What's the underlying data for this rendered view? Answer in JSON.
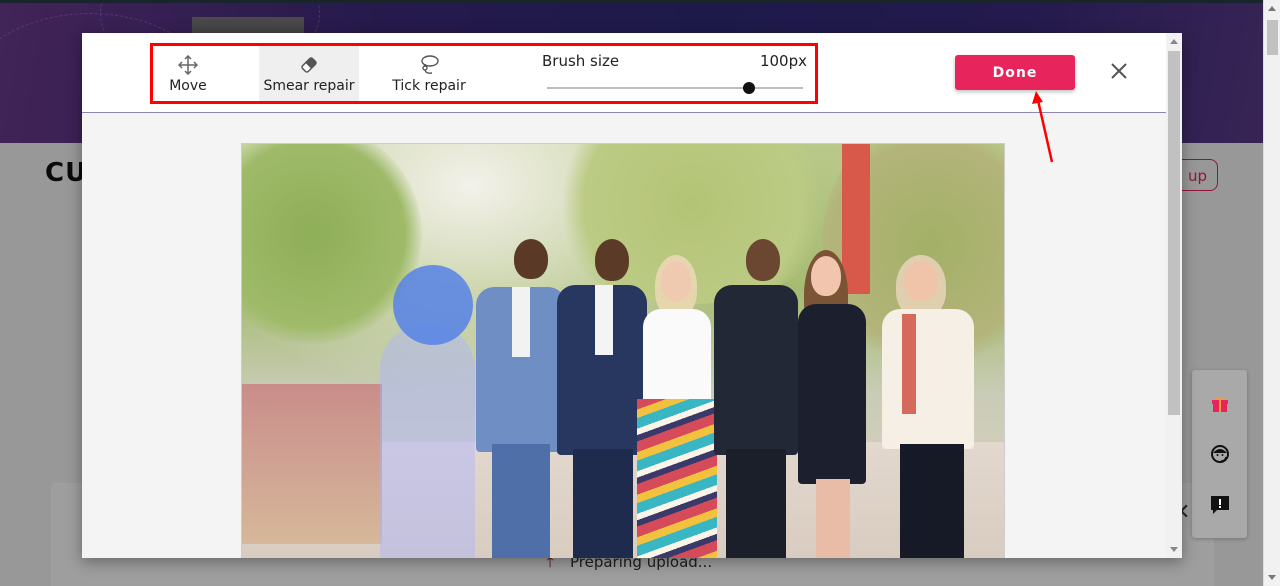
{
  "background_page": {
    "logo_text": "CU",
    "signup_label": "n up",
    "preparing_text": "Preparing upload...",
    "side_widget": [
      {
        "icon": "gift-icon",
        "color": "#e8245c"
      },
      {
        "icon": "support-agent-icon",
        "color": "#111111"
      },
      {
        "icon": "feedback-icon",
        "color": "#111111"
      }
    ]
  },
  "editor": {
    "tools": [
      {
        "id": "move",
        "label": "Move",
        "icon": "move-icon",
        "active": false
      },
      {
        "id": "smear",
        "label": "Smear repair",
        "icon": "eraser-icon",
        "active": true
      },
      {
        "id": "tick",
        "label": "Tick repair",
        "icon": "lasso-icon",
        "active": false
      }
    ],
    "brush_size": {
      "label": "Brush size",
      "value_text": "100px",
      "slider_fraction": 0.79
    },
    "done_label": "Done",
    "close_icon": "close-icon"
  },
  "colors": {
    "accent": "#e8245c",
    "annotation_red": "#ff0000",
    "brush_overlay": "#5682e6"
  }
}
